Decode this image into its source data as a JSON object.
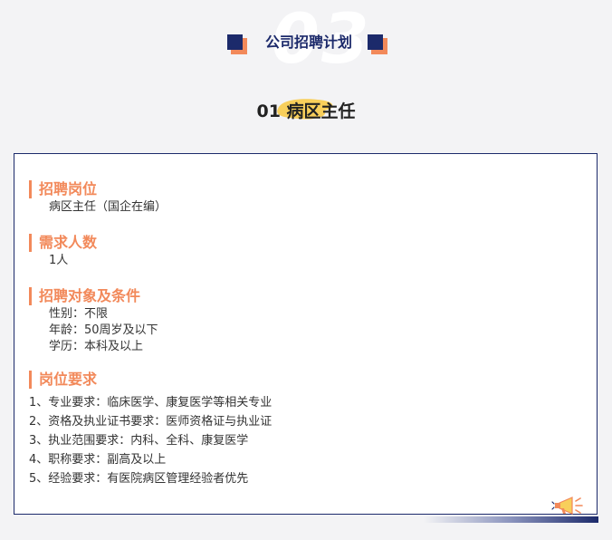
{
  "header": {
    "big_number": "03",
    "section_title": "公司招聘计划",
    "position_title": "01 病区主任"
  },
  "blocks": [
    {
      "heading": "招聘岗位",
      "lines": [
        "病区主任（国企在编）"
      ]
    },
    {
      "heading": "需求人数",
      "lines": [
        "1人"
      ]
    },
    {
      "heading": "招聘对象及条件",
      "lines": [
        "性别：不限",
        "年龄：50周岁及以下",
        "学历：本科及以上"
      ]
    },
    {
      "heading": "岗位要求",
      "lines": [
        "1、专业要求：临床医学、康复医学等相关专业",
        "2、资格及执业证书要求：医师资格证与执业证",
        "3、执业范围要求：内科、全科、康复医学",
        "4、职称要求：副高及以上",
        "5、经验要求：有医院病区管理经验者优先"
      ]
    }
  ],
  "colors": {
    "accent": "#f2895a",
    "navy": "#1c2a6b",
    "brush": "#f8cf5b"
  },
  "icons": {
    "megaphone": "megaphone-icon"
  }
}
